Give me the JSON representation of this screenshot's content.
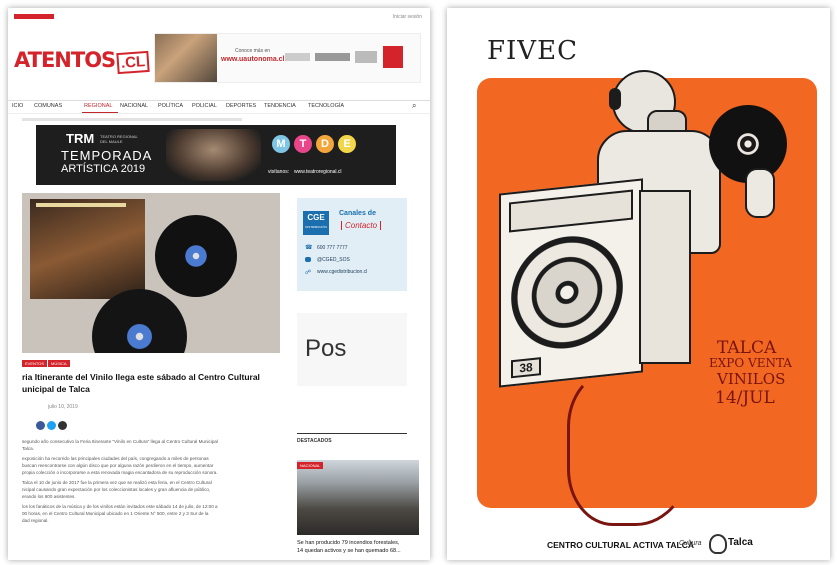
{
  "left": {
    "topbar": {
      "login": "Iniciar sesión"
    },
    "logo": {
      "text": "ATENTOS",
      "suffix": ".CL"
    },
    "ad_banner": {
      "line1": "Conoce más en",
      "url": "www.uautonoma.cl"
    },
    "nav": {
      "items": [
        "ICIO",
        "COMUNAS",
        "REGIONAL",
        "NACIONAL",
        "POLÍTICA",
        "POLICIAL",
        "DEPORTES",
        "TENDENCIA",
        "TECNOLOGÍA"
      ],
      "active_index": 2
    },
    "promo": {
      "brand": "TRM",
      "brand_sub": "TEATRO REGIONAL DEL MAULE",
      "line1": "TEMPORADA",
      "line2": "ARTÍSTICA 2019",
      "letters": [
        "M",
        "T",
        "D",
        "E"
      ],
      "visit": "visítanos:",
      "url": "www.teatroregional.cl"
    },
    "sidebar_ad": {
      "brand": "CGE",
      "brand_sub": "DISTRIBUCIÓN",
      "title": "Canales de",
      "subtitle": "Contacto",
      "phone": "600 777 7777",
      "twitter": "@CGED_SOS",
      "web": "www.cgedistribucion.cl"
    },
    "sidebar_ad2": {
      "text": "Pos"
    },
    "article": {
      "tags": [
        "EVENTOS",
        "MÚSICA"
      ],
      "title_line1": "ria Itinerante del Vinilo llega este sábado al Centro Cultural",
      "title_line2": "unicipal de Talca",
      "date": "julio 10, 2019",
      "paragraphs": [
        "segundo año consecutivo la Feria Itinerante \"Vinilo en Cultura\" llega al Centro Cultural Municipal",
        "Talca.",
        "exposición ha recorrido las principales ciudades del país, congregando a miles de personas",
        "buscan reencontrarse con algún disco que por alguna razón perdieron en el tiempo, aumentar",
        "propia colección o incorporarse a esta renovada magia encantadora de su reproducción sonora.",
        "Talca el 10 de junio de 2017 fue la primera vez que se realizó esta feria, en el Centro Cultural",
        "nicipal causando gran expectación por los coleccionistas locales y gran afluencia de público,",
        "erando los 600 asistentes.",
        "los los fanáticos de la música y de los vinilos están invitados este sábado 14 de julio, de 12:00 a",
        "00 horas, en el Centro Cultural Municipal ubicado en 1 Oriente N° 500, entre 2 y 3 Sur de la",
        "dad regional."
      ]
    },
    "destacados": {
      "heading": "DESTACADOS",
      "tag": "NACIONAL",
      "headline_line1": "Se han producido 79 incendios forestales,",
      "headline_line2": "14 quedan activos y se han quemado 68..."
    }
  },
  "right": {
    "title": "FIVEC",
    "speaker_number": "38",
    "city": "TALCA",
    "line1": "EXPO VENTA",
    "line2": "VINILOS",
    "date": "14/JUL",
    "footer": "CENTRO CULTURAL ACTIVA TALCA",
    "footer_logo1": "Cultura",
    "footer_logo2": "Talca"
  },
  "colors": {
    "brand_red": "#d4232a",
    "poster_orange": "#f26722",
    "poster_dark_red": "#7a1410",
    "nav_active": "#c0282d"
  }
}
